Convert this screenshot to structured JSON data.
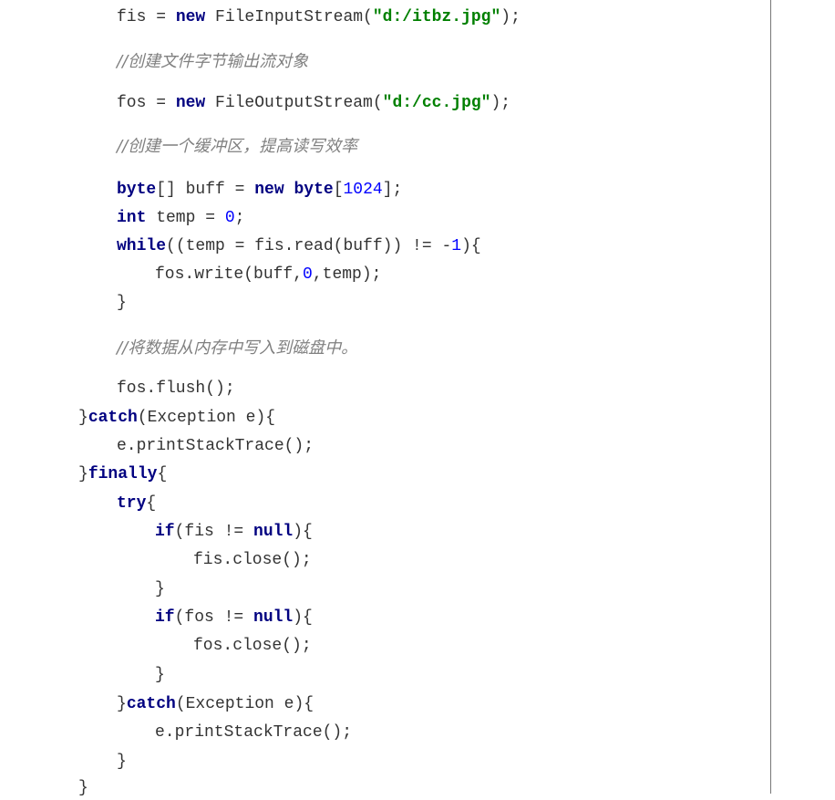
{
  "code": {
    "lines": [
      {
        "indent": 128,
        "tokens": [
          {
            "t": "plain",
            "v": "fis = "
          },
          {
            "t": "kw",
            "v": "new"
          },
          {
            "t": "plain",
            "v": " FileInputStream("
          },
          {
            "t": "str",
            "v": "\"d:/itbz.jpg\""
          },
          {
            "t": "plain",
            "v": ");"
          }
        ]
      },
      {
        "indent": 128,
        "tokens": [
          {
            "t": "cmt",
            "v": "//创建文件字节输出流对象"
          }
        ]
      },
      {
        "indent": 128,
        "tokens": [
          {
            "t": "plain",
            "v": "fos = "
          },
          {
            "t": "kw",
            "v": "new"
          },
          {
            "t": "plain",
            "v": " FileOutputStream("
          },
          {
            "t": "str",
            "v": "\"d:/cc.jpg\""
          },
          {
            "t": "plain",
            "v": ");"
          }
        ]
      },
      {
        "indent": 128,
        "tokens": [
          {
            "t": "cmt",
            "v": "//创建一个缓冲区，提高读写效率"
          }
        ]
      },
      {
        "indent": 128,
        "tokens": [
          {
            "t": "kw",
            "v": "byte"
          },
          {
            "t": "plain",
            "v": "[] buff = "
          },
          {
            "t": "kw",
            "v": "new"
          },
          {
            "t": "plain",
            "v": " "
          },
          {
            "t": "kw",
            "v": "byte"
          },
          {
            "t": "plain",
            "v": "["
          },
          {
            "t": "num",
            "v": "1024"
          },
          {
            "t": "plain",
            "v": "];"
          }
        ]
      },
      {
        "indent": 128,
        "tokens": [
          {
            "t": "kw",
            "v": "int"
          },
          {
            "t": "plain",
            "v": " temp = "
          },
          {
            "t": "num",
            "v": "0"
          },
          {
            "t": "plain",
            "v": ";"
          }
        ]
      },
      {
        "indent": 128,
        "tokens": [
          {
            "t": "kw",
            "v": "while"
          },
          {
            "t": "plain",
            "v": "((temp = fis.read(buff)) != -"
          },
          {
            "t": "num",
            "v": "1"
          },
          {
            "t": "plain",
            "v": "){"
          }
        ]
      },
      {
        "indent": 170,
        "tokens": [
          {
            "t": "plain",
            "v": "fos.write(buff,"
          },
          {
            "t": "num",
            "v": "0"
          },
          {
            "t": "plain",
            "v": ",temp);"
          }
        ]
      },
      {
        "indent": 128,
        "tokens": [
          {
            "t": "plain",
            "v": "}"
          }
        ]
      },
      {
        "indent": 128,
        "tokens": [
          {
            "t": "cmt",
            "v": "//将数据从内存中写入到磁盘中。"
          }
        ]
      },
      {
        "indent": 128,
        "tokens": [
          {
            "t": "plain",
            "v": "fos.flush();"
          }
        ]
      },
      {
        "indent": 86,
        "tokens": [
          {
            "t": "plain",
            "v": "}"
          },
          {
            "t": "kw",
            "v": "catch"
          },
          {
            "t": "plain",
            "v": "(Exception e){"
          }
        ]
      },
      {
        "indent": 128,
        "tokens": [
          {
            "t": "plain",
            "v": "e.printStackTrace();"
          }
        ]
      },
      {
        "indent": 86,
        "tokens": [
          {
            "t": "plain",
            "v": "}"
          },
          {
            "t": "kw",
            "v": "finally"
          },
          {
            "t": "plain",
            "v": "{"
          }
        ]
      },
      {
        "indent": 128,
        "tokens": [
          {
            "t": "kw",
            "v": "try"
          },
          {
            "t": "plain",
            "v": "{"
          }
        ]
      },
      {
        "indent": 170,
        "tokens": [
          {
            "t": "kw",
            "v": "if"
          },
          {
            "t": "plain",
            "v": "(fis != "
          },
          {
            "t": "kw",
            "v": "null"
          },
          {
            "t": "plain",
            "v": "){"
          }
        ]
      },
      {
        "indent": 212,
        "tokens": [
          {
            "t": "plain",
            "v": "fis.close();"
          }
        ]
      },
      {
        "indent": 170,
        "tokens": [
          {
            "t": "plain",
            "v": "}"
          }
        ]
      },
      {
        "indent": 170,
        "tokens": [
          {
            "t": "kw",
            "v": "if"
          },
          {
            "t": "plain",
            "v": "(fos != "
          },
          {
            "t": "kw",
            "v": "null"
          },
          {
            "t": "plain",
            "v": "){"
          }
        ]
      },
      {
        "indent": 212,
        "tokens": [
          {
            "t": "plain",
            "v": "fos.close();"
          }
        ]
      },
      {
        "indent": 170,
        "tokens": [
          {
            "t": "plain",
            "v": "}"
          }
        ]
      },
      {
        "indent": 128,
        "tokens": [
          {
            "t": "plain",
            "v": "}"
          },
          {
            "t": "kw",
            "v": "catch"
          },
          {
            "t": "plain",
            "v": "(Exception e){"
          }
        ]
      },
      {
        "indent": 170,
        "tokens": [
          {
            "t": "plain",
            "v": "e.printStackTrace();"
          }
        ]
      },
      {
        "indent": 128,
        "tokens": [
          {
            "t": "plain",
            "v": "}"
          }
        ]
      },
      {
        "indent": 86,
        "tokens": [
          {
            "t": "plain",
            "v": "}"
          }
        ]
      }
    ]
  }
}
